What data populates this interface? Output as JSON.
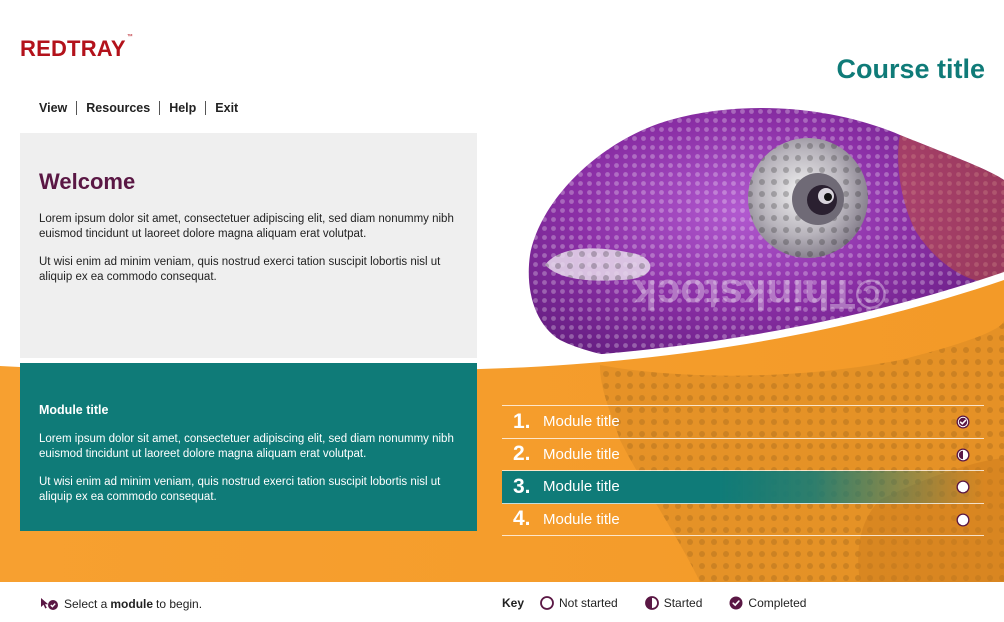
{
  "header": {
    "logo": "REDTRAY",
    "logo_tm": "™",
    "course_title": "Course title"
  },
  "nav": {
    "items": [
      {
        "label": "View"
      },
      {
        "label": "Resources"
      },
      {
        "label": "Help"
      },
      {
        "label": "Exit"
      }
    ]
  },
  "welcome": {
    "title": "Welcome",
    "para1": "Lorem ipsum dolor sit amet, consectetuer adipiscing elit, sed diam nonummy nibh euismod tincidunt ut laoreet dolore magna aliquam erat volutpat.",
    "para2": "Ut wisi enim ad minim veniam, quis nostrud exerci tation suscipit lobortis nisl ut aliquip ex ea commodo consequat."
  },
  "module_info": {
    "title": "Module title",
    "para1": "Lorem ipsum dolor sit amet, consectetuer adipiscing elit, sed diam nonummy nibh euismod tincidunt ut laoreet dolore magna aliquam erat volutpat.",
    "para2": "Ut wisi enim ad minim veniam, quis nostrud exerci tation suscipit lobortis nisl ut aliquip ex ea commodo consequat."
  },
  "hero": {
    "watermark": "©Thinkstock"
  },
  "modules": [
    {
      "number": "1.",
      "label": "Module title",
      "status": "completed"
    },
    {
      "number": "2.",
      "label": "Module title",
      "status": "started"
    },
    {
      "number": "3.",
      "label": "Module title",
      "status": "not-started",
      "active": true
    },
    {
      "number": "4.",
      "label": "Module title",
      "status": "not-started"
    }
  ],
  "footer": {
    "instruction_pre": "Select a",
    "instruction_bold": "module",
    "instruction_post": "to begin.",
    "key_label": "Key",
    "key_not_started": "Not started",
    "key_started": "Started",
    "key_completed": "Completed"
  },
  "colors": {
    "brand_red": "#b3121b",
    "teal": "#0f7b78",
    "orange": "#f7a030",
    "plum": "#5a1744",
    "panel_grey": "#efefef"
  },
  "icons": {
    "completed": "check-circle-icon",
    "started": "half-circle-icon",
    "not_started": "empty-circle-icon",
    "instruction": "cursor-click-icon"
  }
}
